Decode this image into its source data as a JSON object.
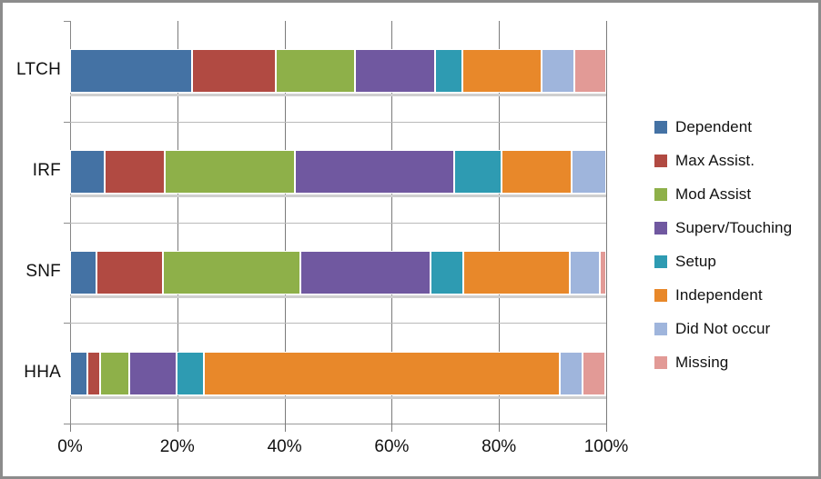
{
  "chart_data": {
    "type": "bar",
    "orientation": "horizontal",
    "stacked": true,
    "normalized_percent": true,
    "title": "",
    "xlabel": "",
    "ylabel": "",
    "xlim": [
      0,
      100
    ],
    "xticks": [
      "0%",
      "20%",
      "40%",
      "60%",
      "80%",
      "100%"
    ],
    "xtick_values": [
      0,
      20,
      40,
      60,
      80,
      100
    ],
    "grid": true,
    "legend_position": "right",
    "categories": [
      "LTCH",
      "IRF",
      "SNF",
      "HHA"
    ],
    "series": [
      {
        "name": "Dependent",
        "color": "#4472a4",
        "values": [
          22.8,
          6.4,
          4.9,
          3.2
        ]
      },
      {
        "name": "Max Assist.",
        "color": "#b14a42",
        "values": [
          15.6,
          11.2,
          12.4,
          2.4
        ]
      },
      {
        "name": "Mod Assist",
        "color": "#8eb049",
        "values": [
          14.8,
          24.3,
          25.6,
          5.4
        ]
      },
      {
        "name": "Superv/Touching",
        "color": "#7058a0",
        "values": [
          14.8,
          29.7,
          24.3,
          8.8
        ]
      },
      {
        "name": "Setup",
        "color": "#2e9bb2",
        "values": [
          5.1,
          8.8,
          6.1,
          5.1
        ]
      },
      {
        "name": "Independent",
        "color": "#e8882a",
        "values": [
          14.9,
          13.1,
          19.9,
          66.5
        ]
      },
      {
        "name": "Did Not occur",
        "color": "#9fb5dc",
        "values": [
          6.1,
          6.5,
          5.6,
          4.2
        ]
      },
      {
        "name": "Missing",
        "color": "#e29a96",
        "values": [
          5.9,
          0.0,
          1.2,
          4.3
        ]
      }
    ]
  },
  "legend": {
    "items": [
      {
        "label": "Dependent"
      },
      {
        "label": "Max Assist."
      },
      {
        "label": "Mod Assist"
      },
      {
        "label": "Superv/Touching"
      },
      {
        "label": "Setup"
      },
      {
        "label": "Independent"
      },
      {
        "label": "Did Not occur"
      },
      {
        "label": "Missing"
      }
    ]
  }
}
